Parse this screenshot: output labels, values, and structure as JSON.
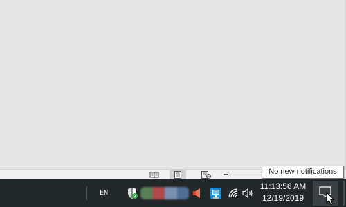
{
  "statusbar": {
    "views": [
      {
        "name": "Read Mode",
        "icon": "book-icon"
      },
      {
        "name": "Print Layout",
        "icon": "print-layout-icon",
        "active": true
      },
      {
        "name": "Web Layout",
        "icon": "web-layout-icon"
      }
    ]
  },
  "taskbar": {
    "language": "EN",
    "tray_icons": [
      "windows-security-icon",
      "blurred-app-icons",
      "speaker-muted-icon",
      "network-app-icon",
      "wifi-icon",
      "volume-icon"
    ],
    "blurred_colors": [
      "#5c7f5a",
      "#b24848",
      "#7b8fb3",
      "#4d6d94"
    ],
    "clock": {
      "time": "11:13:56 AM",
      "date": "12/19/2019"
    },
    "notification_icon": "action-center-icon"
  },
  "tooltip": {
    "text": "No new notifications"
  },
  "colors": {
    "taskbar": "#22272a",
    "statusbar": "#f0f0f0",
    "document": "#e6e6e6",
    "security_green": "#2fb34a",
    "speaker_red": "#e0462c",
    "app_blue": "#1a8dd8"
  }
}
